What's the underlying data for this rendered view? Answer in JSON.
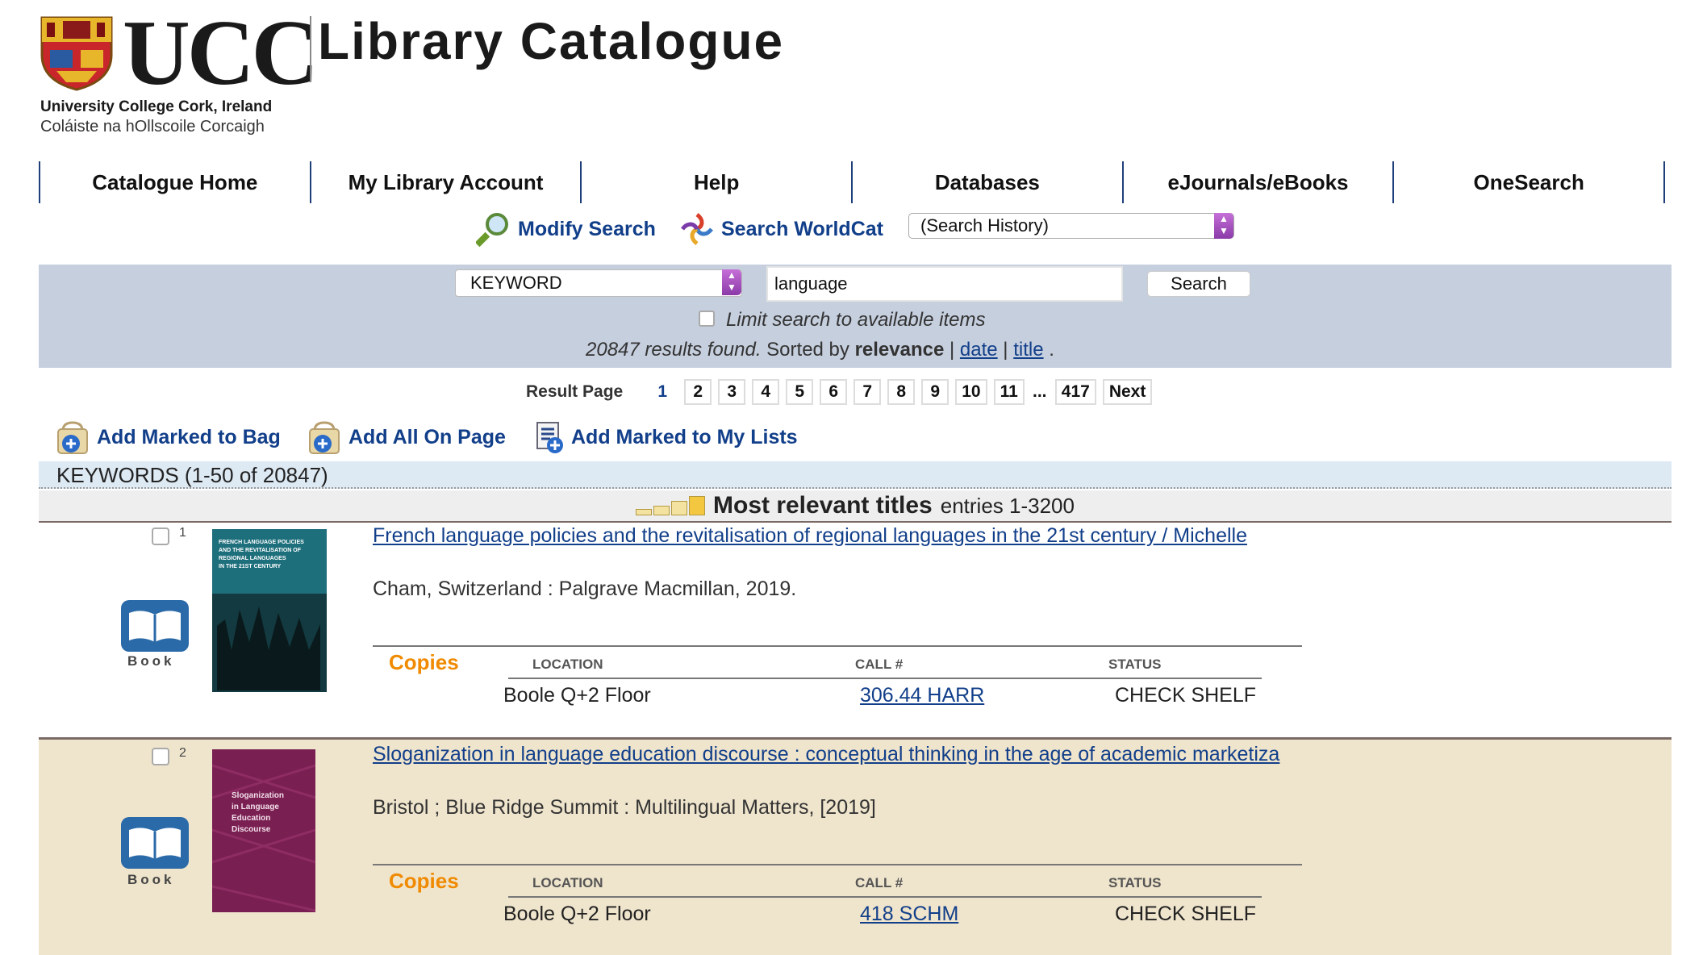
{
  "header": {
    "logo_word": "UCC",
    "logo_line1": "University College Cork, Ireland",
    "logo_line2": "Coláiste na hOllscoile Corcaigh",
    "site_title": "Library Catalogue"
  },
  "nav": [
    "Catalogue Home",
    "My Library Account",
    "Help",
    "Databases",
    "eJournals/eBooks",
    "OneSearch"
  ],
  "tools": {
    "modify_search": "Modify Search",
    "search_worldcat": "Search WorldCat",
    "history_select": "(Search History)"
  },
  "search": {
    "type": "KEYWORD",
    "query": "language",
    "button": "Search",
    "limit_label": "Limit search to available items",
    "results_count_text": "20847 results found.",
    "sorted_by_text": "Sorted by",
    "sort_current": "relevance",
    "sort_date": "date",
    "sort_title": "title"
  },
  "pagination": {
    "label": "Result Page",
    "current": "1",
    "pages": [
      "2",
      "3",
      "4",
      "5",
      "6",
      "7",
      "8",
      "9",
      "10",
      "11"
    ],
    "ellipsis": "...",
    "last": "417",
    "next": "Next"
  },
  "actions": {
    "add_marked_bag": "Add Marked to Bag",
    "add_all_page": "Add All On Page",
    "add_marked_lists": "Add Marked to My Lists"
  },
  "keywords_bar": "KEYWORDS (1-50 of 20847)",
  "relevance": {
    "title": "Most relevant titles",
    "entries": "entries 1-3200"
  },
  "results": [
    {
      "num": "1",
      "format": "Book",
      "title": "French language policies and the revitalisation of regional languages in the 21st century / Michelle",
      "pub": "Cham, Switzerland : Palgrave Macmillan, 2019.",
      "copies_label": "Copies",
      "col_location": "LOCATION",
      "col_call": "CALL #",
      "col_status": "STATUS",
      "location": "Boole Q+2 Floor",
      "call_number": "306.44 HARR",
      "status": "CHECK SHELF",
      "cover_text": "FRENCH LANGUAGE POLICIES AND THE REVITALISATION OF REGIONAL LANGUAGES IN THE 21ST CENTURY",
      "cover_color": "#1e6f7c"
    },
    {
      "num": "2",
      "format": "Book",
      "title": "Sloganization in language education discourse : conceptual thinking in the age of academic marketiza",
      "pub": "Bristol ; Blue Ridge Summit : Multilingual Matters, [2019]",
      "copies_label": "Copies",
      "col_location": "LOCATION",
      "col_call": "CALL #",
      "col_status": "STATUS",
      "location": "Boole Q+2 Floor",
      "call_number": "418 SCHM",
      "status": "CHECK SHELF",
      "cover_text": "Sloganization in Language Education Discourse",
      "cover_color": "#7a1f52"
    }
  ],
  "colors": {
    "link": "#123f8a",
    "nav_border": "#1f3f7a",
    "search_panel": "#c6cfde",
    "copies": "#f08a00",
    "row_alt": "#efe4cc"
  }
}
